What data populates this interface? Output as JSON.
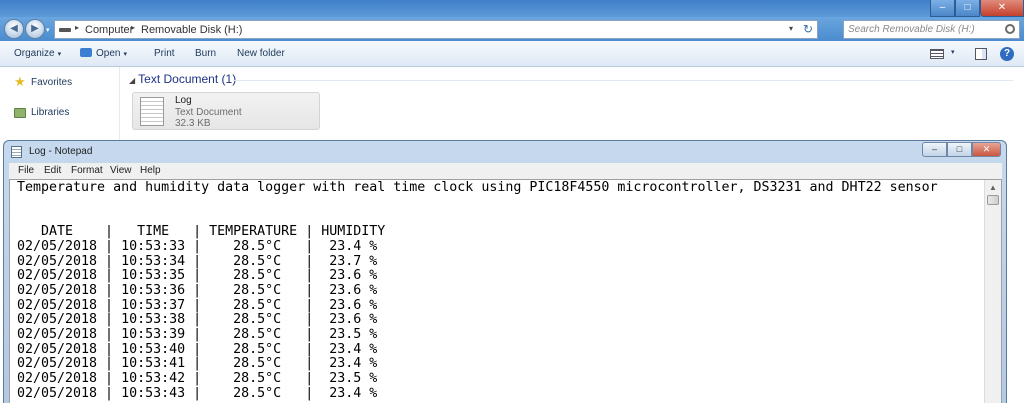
{
  "explorer": {
    "title_buttons": {
      "minimize": "–",
      "maximize": "□",
      "close": "✕"
    },
    "nav": {
      "back": "◀",
      "forward": "▶",
      "dropdown": "▾"
    },
    "breadcrumb": [
      "Computer",
      "Removable Disk (H:)"
    ],
    "breadcrumb_separator": "▸",
    "address_dropdown": "▾",
    "refresh": "↻",
    "search_placeholder": "Search Removable Disk (H:)",
    "toolbar": {
      "organize": "Organize",
      "open": "Open",
      "print": "Print",
      "burn": "Burn",
      "new_folder": "New folder",
      "caret": "▾",
      "help": "?"
    },
    "sidebar": {
      "items": [
        {
          "label": "Favorites",
          "icon": "star-icon"
        },
        {
          "label": "Libraries",
          "icon": "libraries-icon"
        }
      ]
    },
    "group": {
      "label": "Text Document (1)",
      "caret": "◢"
    },
    "file": {
      "name": "Log",
      "type": "Text Document",
      "size": "32.3 KB"
    }
  },
  "notepad": {
    "title": "Log - Notepad",
    "title_buttons": {
      "minimize": "–",
      "maximize": "□",
      "close": "✕"
    },
    "menu": [
      "File",
      "Edit",
      "Format",
      "View",
      "Help"
    ],
    "scroll_up": "▲",
    "header_line": "Temperature and humidity data logger with real time clock using PIC18F4550 microcontroller, DS3231 and DHT22 sensor",
    "table_header": "   DATE    |   TIME   | TEMPERATURE | HUMIDITY",
    "rows": [
      "02/05/2018 | 10:53:33 |    28.5°C   |  23.4 %",
      "02/05/2018 | 10:53:34 |    28.5°C   |  23.7 %",
      "02/05/2018 | 10:53:35 |    28.5°C   |  23.6 %",
      "02/05/2018 | 10:53:36 |    28.5°C   |  23.6 %",
      "02/05/2018 | 10:53:37 |    28.5°C   |  23.6 %",
      "02/05/2018 | 10:53:38 |    28.5°C   |  23.6 %",
      "02/05/2018 | 10:53:39 |    28.5°C   |  23.5 %",
      "02/05/2018 | 10:53:40 |    28.5°C   |  23.4 %",
      "02/05/2018 | 10:53:41 |    28.5°C   |  23.4 %",
      "02/05/2018 | 10:53:42 |    28.5°C   |  23.5 %",
      "02/05/2018 | 10:53:43 |    28.5°C   |  23.4 %"
    ]
  }
}
